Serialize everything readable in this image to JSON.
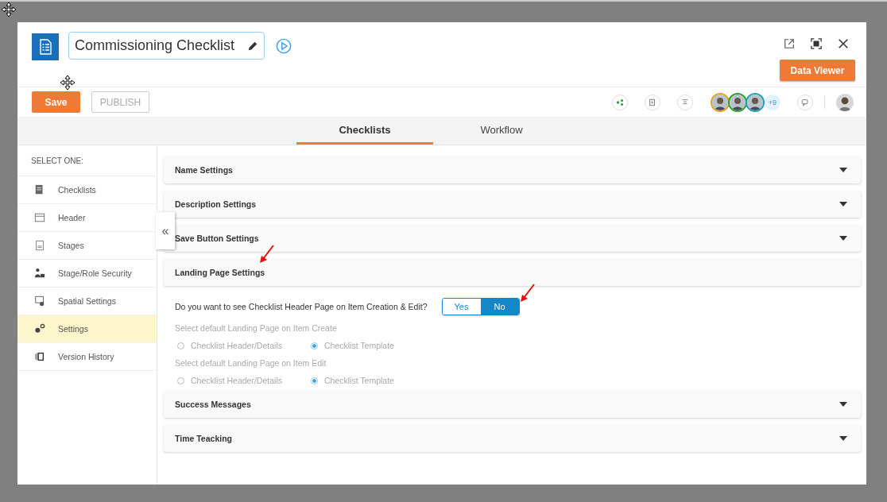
{
  "title": "Commissioning Checklist",
  "header_buttons": {
    "data_viewer": "Data Viewer"
  },
  "toolbar": {
    "save": "Save",
    "publish": "PUBLISH",
    "avatars": [
      {
        "color": "#e0a020"
      },
      {
        "color": "#2aa02a"
      },
      {
        "color": "#20a0b0"
      }
    ],
    "more_count": "+9"
  },
  "tabs": [
    {
      "label": "Checklists",
      "selected": true
    },
    {
      "label": "Workflow",
      "selected": false
    }
  ],
  "sidebar": {
    "heading": "SELECT ONE:",
    "items": [
      {
        "label": "Checklists",
        "kind": "checklist",
        "selected": false
      },
      {
        "label": "Header",
        "kind": "header",
        "selected": false
      },
      {
        "label": "Stages",
        "kind": "stages",
        "selected": false
      },
      {
        "label": "Stage/Role Security",
        "kind": "security",
        "selected": false
      },
      {
        "label": "Spatial Settings",
        "kind": "spatial",
        "selected": false
      },
      {
        "label": "Settings",
        "kind": "gears",
        "selected": true
      },
      {
        "label": "Version History",
        "kind": "history",
        "selected": false
      }
    ]
  },
  "collapse_glyph": "«",
  "sections": [
    {
      "title": "Name Settings",
      "expanded": false,
      "annotated": false
    },
    {
      "title": "Description Settings",
      "expanded": false,
      "annotated": false
    },
    {
      "title": "Save Button Settings",
      "expanded": false,
      "annotated": false
    },
    {
      "title": "Landing Page Settings",
      "expanded": true,
      "annotated": true
    },
    {
      "title": "Success Messages",
      "expanded": false,
      "annotated": false
    },
    {
      "title": "Time Teacking",
      "expanded": false,
      "annotated": false
    }
  ],
  "landing": {
    "question": "Do you want to see Checklist Header Page on Item Creation & Edit?",
    "toggle": [
      {
        "label": "Yes",
        "selected": false
      },
      {
        "label": "No",
        "selected": true
      }
    ],
    "toggle_annotated": true,
    "groups": [
      {
        "label": "Select default Landing Page on Item Create",
        "disabled": true,
        "options": [
          {
            "label": "Checklist Header/Details",
            "selected": false
          },
          {
            "label": "Checklist Template",
            "selected": true
          }
        ]
      },
      {
        "label": "Select default Landing Page on Item Edit",
        "disabled": true,
        "options": [
          {
            "label": "Checklist Header/Details",
            "selected": false
          },
          {
            "label": "Checklist Template",
            "selected": true
          }
        ]
      }
    ]
  }
}
